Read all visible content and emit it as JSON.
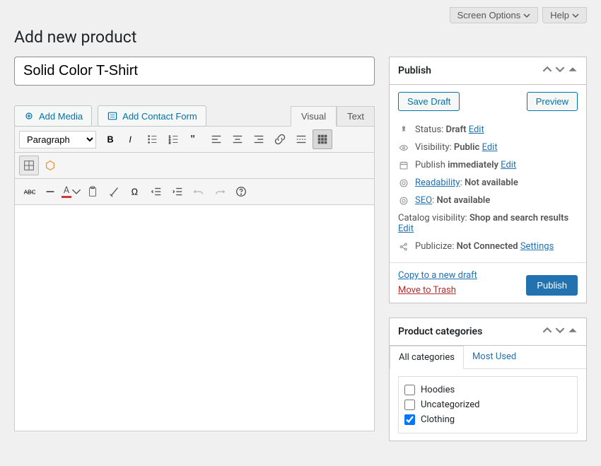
{
  "topTabs": {
    "screenOptions": "Screen Options",
    "help": "Help"
  },
  "pageTitle": "Add new product",
  "titleInput": "Solid Color T-Shirt",
  "mediaButtons": {
    "addMedia": "Add Media",
    "addContactForm": "Add Contact Form"
  },
  "editorTabs": {
    "visual": "Visual",
    "text": "Text"
  },
  "toolbar": {
    "format": "Paragraph"
  },
  "publish": {
    "title": "Publish",
    "saveDraft": "Save Draft",
    "preview": "Preview",
    "statusLabel": "Status: ",
    "statusValue": "Draft",
    "visibilityLabel": "Visibility: ",
    "visibilityValue": "Public",
    "publishLabel": "Publish ",
    "publishValue": "immediately",
    "readabilityLabel": "Readability",
    "readabilityValue": "Not available",
    "seoLabel": "SEO",
    "seoValue": "Not available",
    "catalogLabel": "Catalog visibility: ",
    "catalogValue": "Shop and search results",
    "publicizeLabel": "Publicize: ",
    "publicizeValue": "Not Connected",
    "settings": "Settings",
    "edit": "Edit",
    "copyDraft": "Copy to a new draft",
    "moveTrash": "Move to Trash",
    "publishBtn": "Publish"
  },
  "categories": {
    "title": "Product categories",
    "tabAll": "All categories",
    "tabMost": "Most Used",
    "items": [
      {
        "label": "Hoodies",
        "checked": false
      },
      {
        "label": "Uncategorized",
        "checked": false
      },
      {
        "label": "Clothing",
        "checked": true
      }
    ]
  }
}
